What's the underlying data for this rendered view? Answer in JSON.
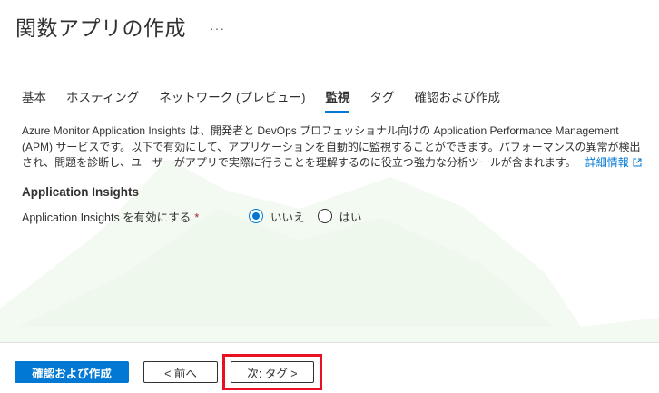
{
  "header": {
    "title": "関数アプリの作成",
    "more_label": "···"
  },
  "tabs": [
    {
      "label": "基本",
      "active": false
    },
    {
      "label": "ホスティング",
      "active": false
    },
    {
      "label": "ネットワーク (プレビュー)",
      "active": false
    },
    {
      "label": "監視",
      "active": true
    },
    {
      "label": "タグ",
      "active": false
    },
    {
      "label": "確認および作成",
      "active": false
    }
  ],
  "description": {
    "text": "Azure Monitor Application Insights は、開発者と DevOps プロフェッショナル向けの Application Performance Management (APM) サービスです。以下で有効にして、アプリケーションを自動的に監視することができます。パフォーマンスの異常が検出され、問題を診断し、ユーザーがアプリで実際に行うことを理解するのに役立つ強力な分析ツールが含まれます。",
    "link_label": "詳細情報"
  },
  "section": {
    "title": "Application Insights",
    "field_label": "Application Insights を有効にする",
    "required_mark": "*",
    "options": [
      {
        "label": "いいえ",
        "selected": true
      },
      {
        "label": "はい",
        "selected": false
      }
    ]
  },
  "footer": {
    "review_create_label": "確認および作成",
    "prev_label": "< 前へ",
    "next_label": "次: タグ >"
  },
  "colors": {
    "accent": "#0078d4",
    "highlight": "#e81123",
    "required": "#a4262c"
  }
}
